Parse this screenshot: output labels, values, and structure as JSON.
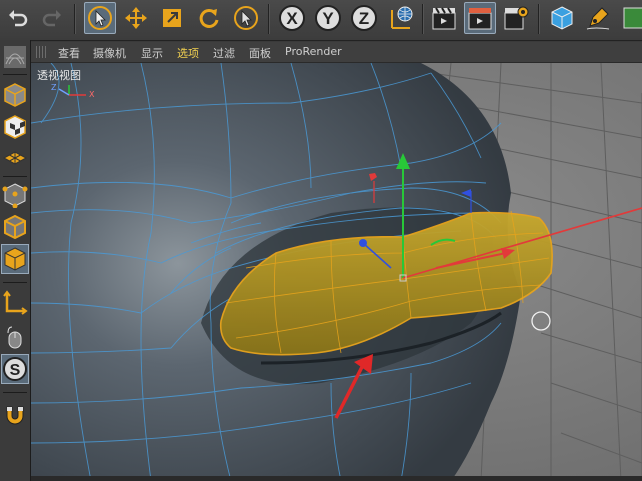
{
  "viewport": {
    "label": "透视视图",
    "axis_z": "Z",
    "axis_x": "X"
  },
  "menu": {
    "items": [
      "查看",
      "摄像机",
      "显示",
      "选项",
      "过滤",
      "面板",
      "ProRender"
    ],
    "active_index": 3
  },
  "toolbar": {
    "axis_x_label": "X",
    "axis_y_label": "Y",
    "axis_z_label": "Z",
    "modeling_label": "S"
  },
  "colors": {
    "selection": "#e8a41c",
    "selected_face": "#b89a20",
    "wire": "#4a9ad6",
    "mesh": "#4b5660",
    "axis_x": "#e23a3a",
    "axis_y": "#28c838",
    "axis_z": "#3050e0",
    "arrow": "#e02828",
    "active_menu": "#f2d150"
  }
}
